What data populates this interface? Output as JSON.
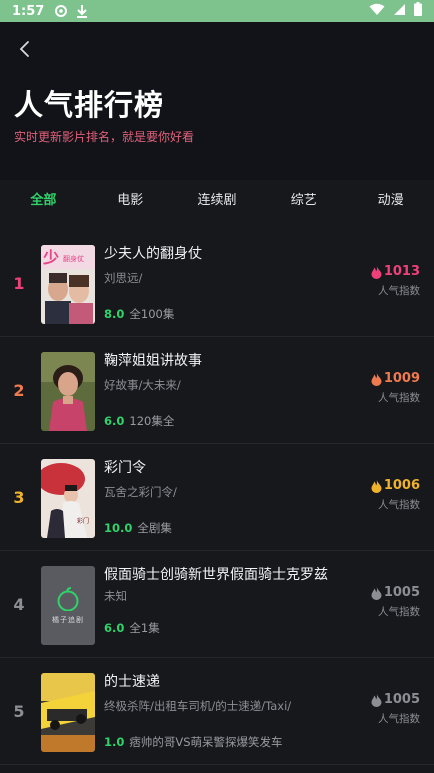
{
  "status": {
    "time": "1:57"
  },
  "header": {
    "title": "人气排行榜",
    "subtitle": "实时更新影片排名，就是要你好看"
  },
  "tabs": [
    {
      "label": "全部",
      "active": true
    },
    {
      "label": "电影"
    },
    {
      "label": "连续剧"
    },
    {
      "label": "综艺"
    },
    {
      "label": "动漫"
    }
  ],
  "colors": {
    "accent": "#2fd36a",
    "rank1": "#f0407a",
    "rank2": "#f07a50",
    "rank3": "#f0b22a",
    "rank_other": "#8d8e93"
  },
  "items": [
    {
      "rank": "1",
      "name": "少夫人的翻身仗",
      "alias": "刘思远/",
      "score": "8.0",
      "extra": "全100集",
      "hot": "1013",
      "hot_label": "人气指数"
    },
    {
      "rank": "2",
      "name": "鞠萍姐姐讲故事",
      "alias": "好故事/大未来/",
      "score": "6.0",
      "extra": "120集全",
      "hot": "1009",
      "hot_label": "人气指数"
    },
    {
      "rank": "3",
      "name": "彩门令",
      "alias": "瓦舍之彩门令/",
      "score": "10.0",
      "extra": "全剧集",
      "hot": "1006",
      "hot_label": "人气指数"
    },
    {
      "rank": "4",
      "name": "假面骑士创骑新世界假面骑士克罗兹",
      "alias": "未知",
      "score": "6.0",
      "extra": "全1集",
      "hot": "1005",
      "hot_label": "人气指数",
      "poster_text": "橘子追剧"
    },
    {
      "rank": "5",
      "name": "的士速递",
      "alias": "终极杀阵/出租车司机/的士速递/Taxi/",
      "score": "1.0",
      "extra": "痞帅的哥VS萌呆警探爆笑发车",
      "hot": "1005",
      "hot_label": "人气指数"
    }
  ]
}
